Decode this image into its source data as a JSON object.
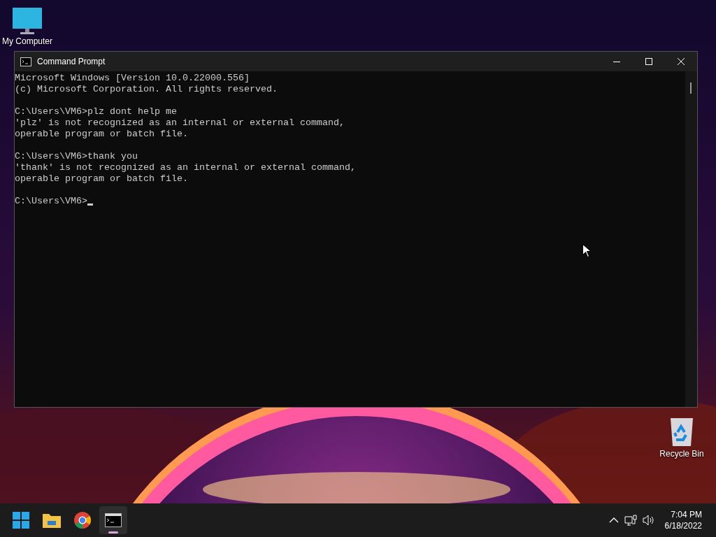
{
  "desktop_icons": [
    {
      "kind": "computer",
      "label": "My Computer"
    },
    {
      "kind": "recycle",
      "label": "Recycle Bin"
    }
  ],
  "window": {
    "title": "Command Prompt",
    "blocks": [
      [
        "Microsoft Windows [Version 10.0.22000.556]",
        "(c) Microsoft Corporation. All rights reserved."
      ],
      [
        "C:\\Users\\VM6>plz dont help me",
        "'plz' is not recognized as an internal or external command,",
        "operable program or batch file."
      ],
      [
        "C:\\Users\\VM6>thank you",
        "'thank' is not recognized as an internal or external command,",
        "operable program or batch file."
      ]
    ],
    "prompt": "C:\\Users\\VM6>"
  },
  "taskbar": {
    "apps": [
      {
        "kind": "start",
        "active": false
      },
      {
        "kind": "folder",
        "active": false
      },
      {
        "kind": "browser",
        "active": false
      },
      {
        "kind": "terminal",
        "active": true
      }
    ],
    "clock": {
      "time": "7:04 PM",
      "date": "6/18/2022"
    }
  }
}
